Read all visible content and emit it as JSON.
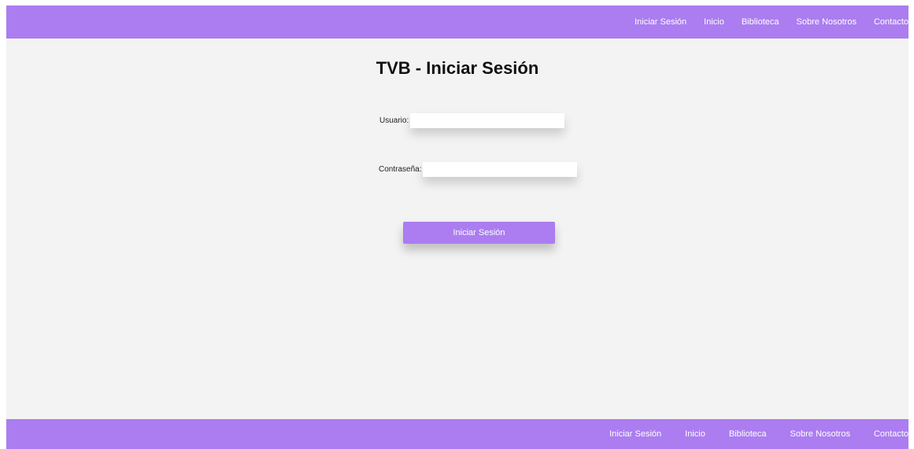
{
  "nav": {
    "items": [
      {
        "label": "Iniciar Sesión"
      },
      {
        "label": "Inicio"
      },
      {
        "label": "Biblioteca"
      },
      {
        "label": "Sobre Nosotros"
      },
      {
        "label": "Contacto"
      }
    ]
  },
  "main": {
    "title": "TVB - Iniciar Sesión",
    "username_label": "Usuario:",
    "username_value": "",
    "password_label": "Contraseña:",
    "password_value": "",
    "submit_label": "Iniciar Sesión"
  },
  "footer": {
    "items": [
      {
        "label": "Iniciar Sesión"
      },
      {
        "label": "Inicio"
      },
      {
        "label": "Biblioteca"
      },
      {
        "label": "Sobre Nosotros"
      },
      {
        "label": "Contacto"
      }
    ]
  },
  "colors": {
    "accent": "#ab7df0",
    "background": "#f3f3f3"
  }
}
